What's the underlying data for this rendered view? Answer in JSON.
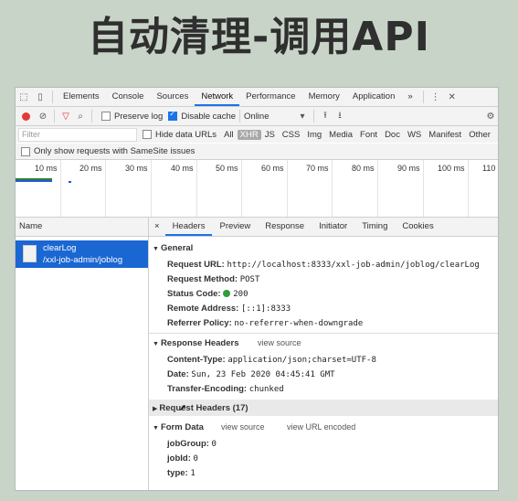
{
  "slide_title": "自动清理-调用API",
  "tabbar": {
    "tabs": [
      "Elements",
      "Console",
      "Sources",
      "Network",
      "Performance",
      "Memory",
      "Application"
    ],
    "active": "Network",
    "more": "»",
    "kebab": "⋮",
    "close": "✕"
  },
  "toolbar": {
    "preserve_log": "Preserve log",
    "disable_cache": "Disable cache",
    "throttle": "Online"
  },
  "filterbar": {
    "placeholder": "Filter",
    "hide_data_urls": "Hide data URLs",
    "types": [
      "All",
      "XHR",
      "JS",
      "CSS",
      "Img",
      "Media",
      "Font",
      "Doc",
      "WS",
      "Manifest",
      "Other"
    ],
    "selected_type": "XHR"
  },
  "samesite": "Only show requests with SameSite issues",
  "timeline": {
    "ticks": [
      "10 ms",
      "20 ms",
      "30 ms",
      "40 ms",
      "50 ms",
      "60 ms",
      "70 ms",
      "80 ms",
      "90 ms",
      "100 ms",
      "110"
    ]
  },
  "left": {
    "header": "Name",
    "request": {
      "name": "clearLog",
      "path": "/xxl-job-admin/joblog"
    }
  },
  "detail_tabs": {
    "close": "×",
    "tabs": [
      "Headers",
      "Preview",
      "Response",
      "Initiator",
      "Timing",
      "Cookies"
    ],
    "active": "Headers"
  },
  "general": {
    "title": "General",
    "request_url_label": "Request URL:",
    "request_url": "http://localhost:8333/xxl-job-admin/joblog/clearLog",
    "method_label": "Request Method:",
    "method": "POST",
    "status_label": "Status Code:",
    "status": "200",
    "status_color": "#2e9e3c",
    "remote_label": "Remote Address:",
    "remote": "[::1]:8333",
    "referrer_label": "Referrer Policy:",
    "referrer": "no-referrer-when-downgrade"
  },
  "response_headers": {
    "title": "Response Headers",
    "view_source": "view source",
    "content_type_label": "Content-Type:",
    "content_type": "application/json;charset=UTF-8",
    "date_label": "Date:",
    "date": "Sun, 23 Feb 2020 04:45:41 GMT",
    "te_label": "Transfer-Encoding:",
    "te": "chunked"
  },
  "request_headers": {
    "title": "Request Headers (17)"
  },
  "form_data": {
    "title": "Form Data",
    "view_source": "view source",
    "view_url_encoded": "view URL encoded",
    "fields": [
      {
        "key": "jobGroup:",
        "value": "0"
      },
      {
        "key": "jobId:",
        "value": "0"
      },
      {
        "key": "type:",
        "value": "1"
      }
    ]
  }
}
